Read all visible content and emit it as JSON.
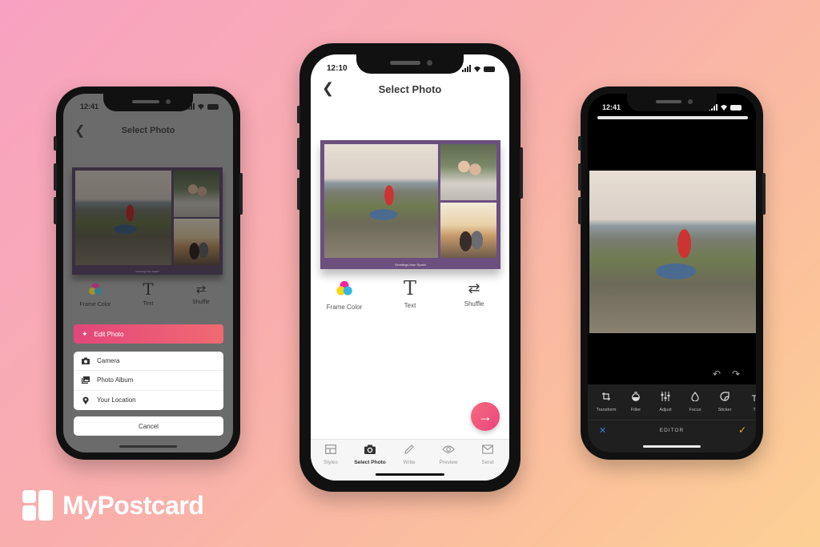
{
  "brand": {
    "name": "MyPostcard",
    "logo_icon": "postcard-grid-icon"
  },
  "colors": {
    "accent_gradient_start": "#e2467a",
    "accent_gradient_end": "#f16a73",
    "card_frame": "#6c4f7e",
    "editor_cancel": "#3e7bd6",
    "editor_confirm": "#f0b323"
  },
  "phone_left": {
    "status_time": "12:41",
    "nav": {
      "back_icon": "chevron-left-icon",
      "title": "Select Photo"
    },
    "card_caption": "Greetings from Spain!",
    "tools": [
      {
        "icon": "frame-color-icon",
        "label": "Frame Color"
      },
      {
        "icon": "text-icon",
        "label": "Text"
      },
      {
        "icon": "shuffle-icon",
        "label": "Shuffle"
      }
    ],
    "edit_photo": {
      "icon": "magic-wand-icon",
      "label": "Edit Photo"
    },
    "action_sheet": [
      {
        "icon": "camera-icon",
        "label": "Camera"
      },
      {
        "icon": "photo-album-icon",
        "label": "Photo Album"
      },
      {
        "icon": "location-pin-icon",
        "label": "Your Location"
      }
    ],
    "cancel_label": "Cancel"
  },
  "phone_center": {
    "status_time": "12:10",
    "nav": {
      "back_icon": "chevron-left-icon",
      "title": "Select Photo"
    },
    "card_caption": "Greetings from Spain!",
    "tools": [
      {
        "icon": "frame-color-icon",
        "label": "Frame Color"
      },
      {
        "icon": "text-icon",
        "label": "Text"
      },
      {
        "icon": "shuffle-icon",
        "label": "Shuffle"
      }
    ],
    "fab_icon": "arrow-right-icon",
    "tabs": [
      {
        "icon": "styles-icon",
        "label": "Styles",
        "active": false
      },
      {
        "icon": "camera-icon",
        "label": "Select Photo",
        "active": true
      },
      {
        "icon": "pencil-icon",
        "label": "Write",
        "active": false
      },
      {
        "icon": "eye-icon",
        "label": "Preview",
        "active": false
      },
      {
        "icon": "envelope-icon",
        "label": "Send",
        "active": false
      }
    ]
  },
  "phone_right": {
    "status_time": "12:41",
    "undo_icon": "undo-icon",
    "redo_icon": "redo-icon",
    "tools": [
      {
        "icon": "transform-icon",
        "label": "Transform"
      },
      {
        "icon": "filter-icon",
        "label": "Filter"
      },
      {
        "icon": "adjust-icon",
        "label": "Adjust"
      },
      {
        "icon": "focus-icon",
        "label": "Focus"
      },
      {
        "icon": "sticker-icon",
        "label": "Sticker"
      },
      {
        "icon": "text-icon",
        "label": "T"
      }
    ],
    "bottom_bar": {
      "cancel_icon": "close-icon",
      "title": "EDITOR",
      "confirm_icon": "checkmark-icon"
    }
  }
}
